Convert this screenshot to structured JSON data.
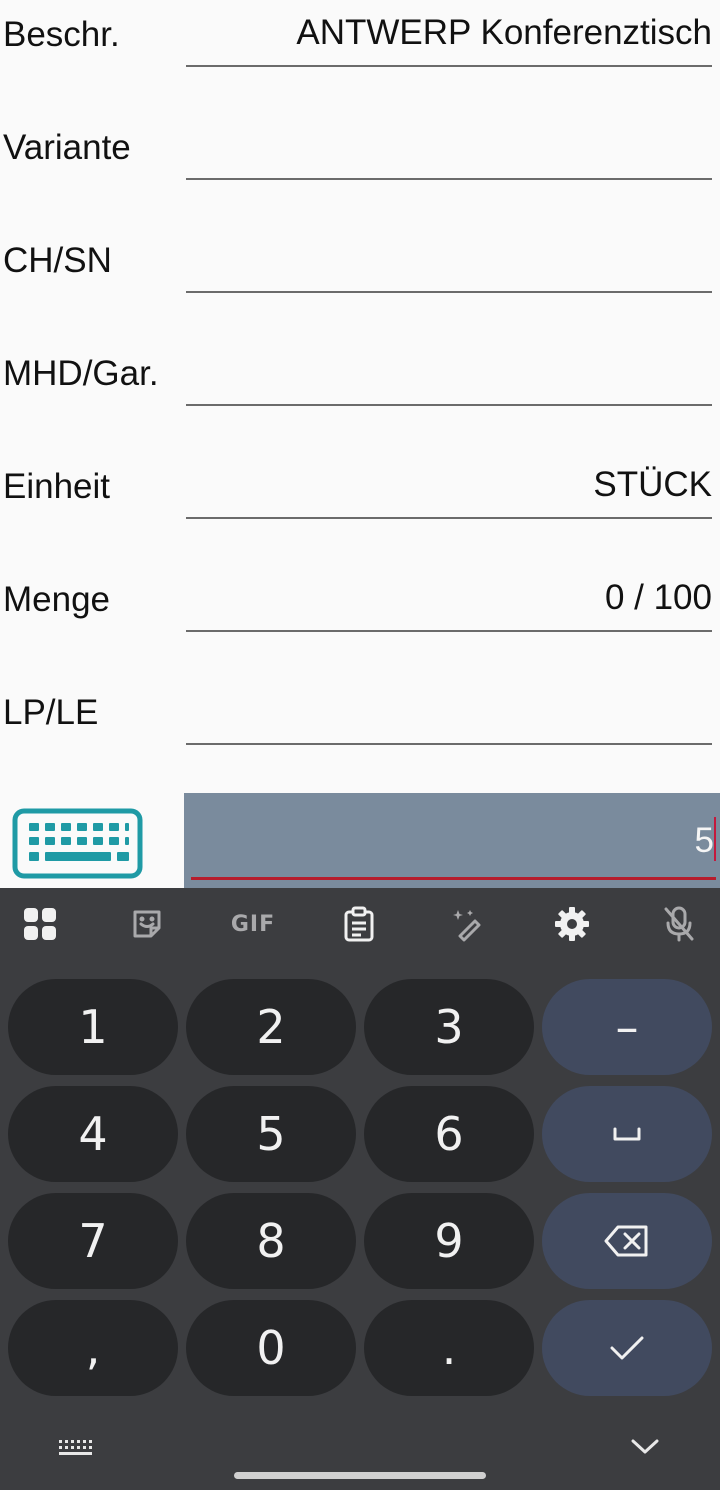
{
  "form": {
    "rows": [
      {
        "label": "Beschr.",
        "value": "ANTWERP Konferenztisch"
      },
      {
        "label": "Variante",
        "value": ""
      },
      {
        "label": "CH/SN",
        "value": ""
      },
      {
        "label": "MHD/Gar.",
        "value": ""
      },
      {
        "label": "Einheit",
        "value": "STÜCK"
      },
      {
        "label": "Menge",
        "value": "0 / 100"
      },
      {
        "label": "LP/LE",
        "value": ""
      }
    ]
  },
  "entry": {
    "value": "5"
  },
  "keyboard": {
    "toolbar": {
      "apps": "apps-grid-icon",
      "sticker": "sticker-icon",
      "gif": "GIF",
      "clipboard": "clipboard-icon",
      "magic": "magic-edit-icon",
      "settings": "settings-gear-icon",
      "mic": "mic-off-icon"
    },
    "keys": {
      "k1": "1",
      "k2": "2",
      "k3": "3",
      "k4": "4",
      "k5": "5",
      "k6": "6",
      "k7": "7",
      "k8": "8",
      "k9": "9",
      "comma": ",",
      "k0": "0",
      "period": ".",
      "minus": "–"
    }
  },
  "colors": {
    "page_bg": "#fafafa",
    "entry_bg": "#7a8b9d",
    "accent_red": "#b71c2c",
    "teal_icon": "#1f9aa5",
    "keyboard_bg": "#3c3d40",
    "key_bg": "#262729",
    "fn_key_bg": "#414a5f"
  }
}
